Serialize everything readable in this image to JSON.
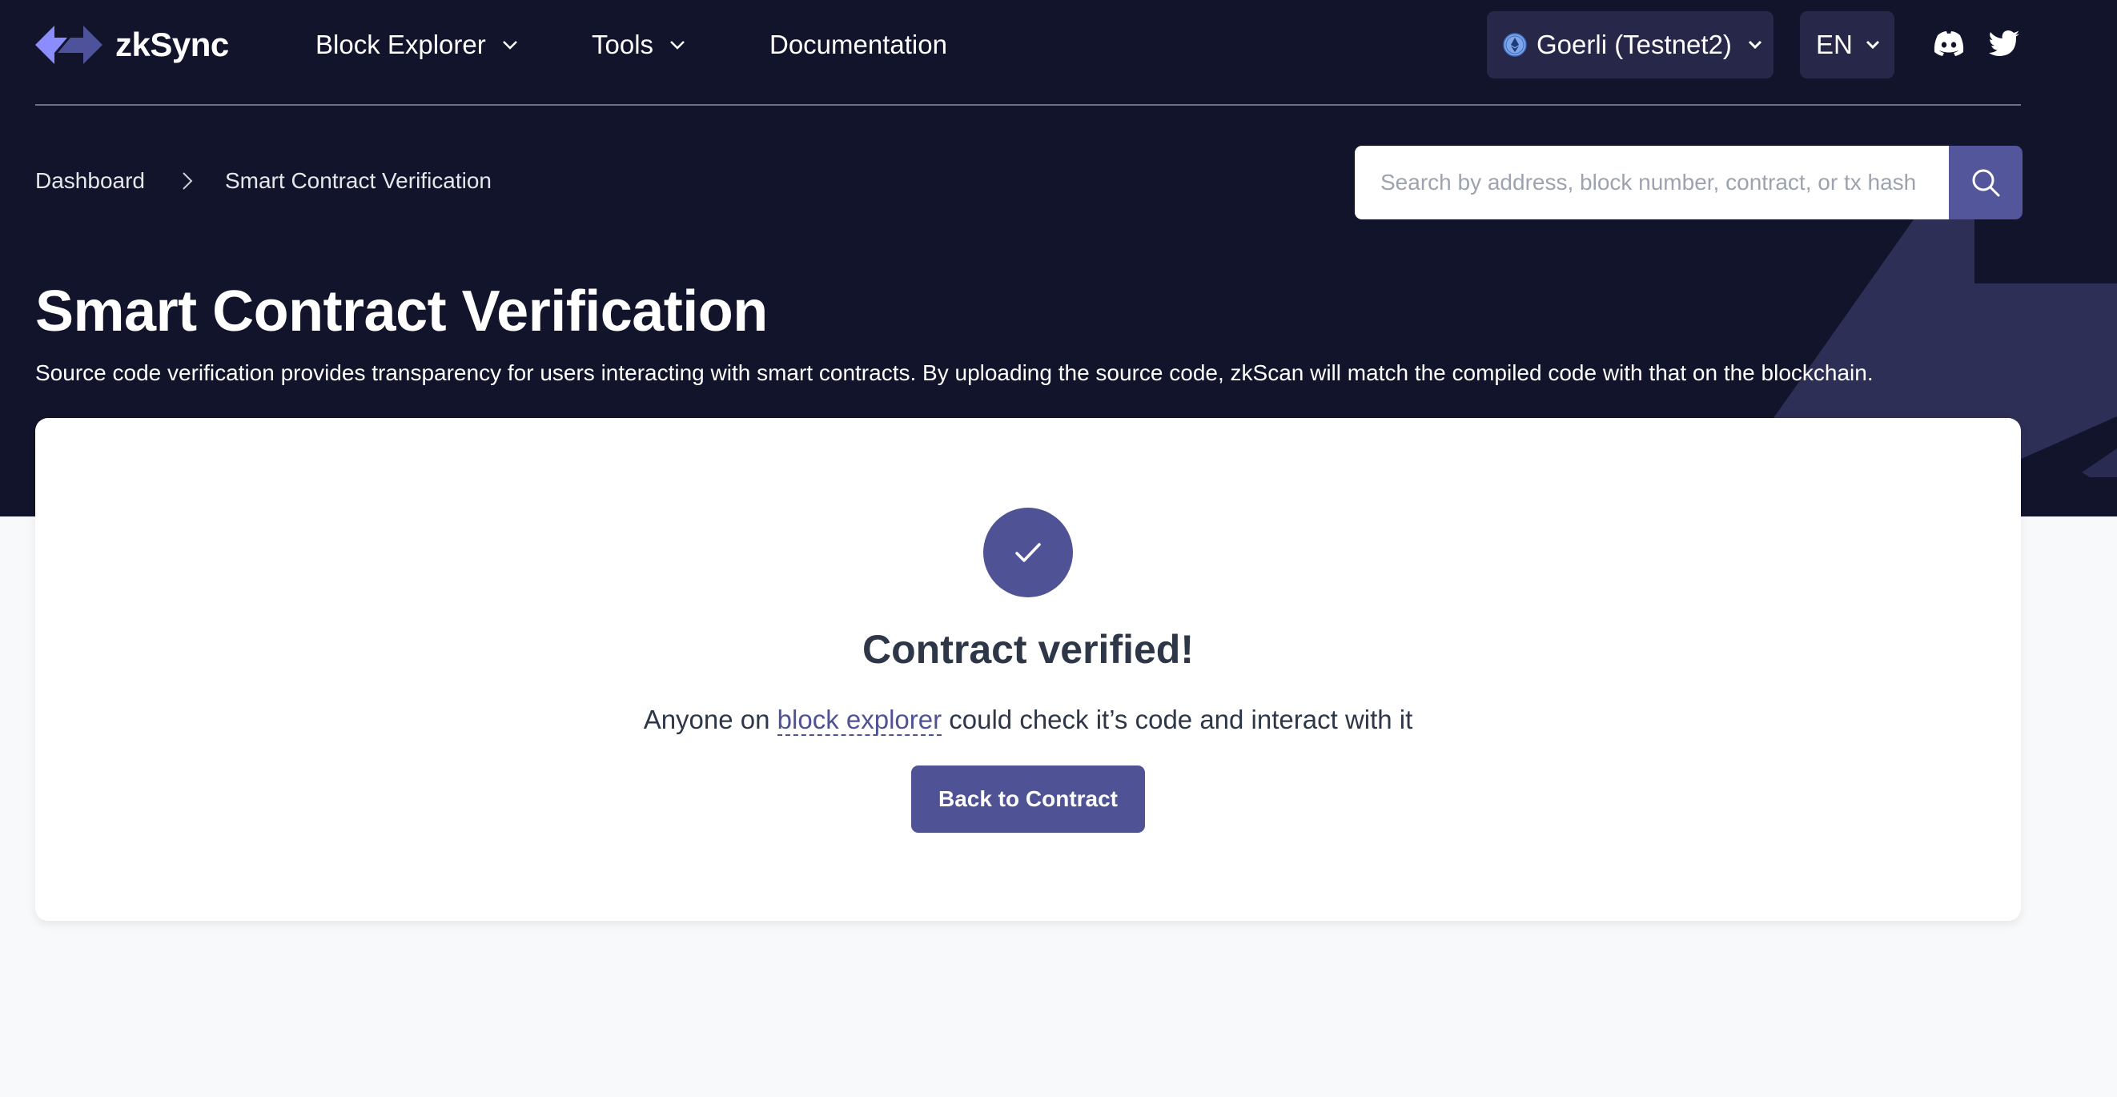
{
  "header": {
    "logo_text": "zkSync",
    "nav": [
      {
        "label": "Block Explorer",
        "has_dropdown": true
      },
      {
        "label": "Tools",
        "has_dropdown": true
      },
      {
        "label": "Documentation",
        "has_dropdown": false
      }
    ],
    "network": {
      "label": "Goerli (Testnet2)",
      "icon": "ethereum-icon"
    },
    "language": {
      "label": "EN"
    },
    "social": [
      {
        "name": "discord",
        "icon": "discord-icon"
      },
      {
        "name": "twitter",
        "icon": "twitter-icon"
      }
    ]
  },
  "breadcrumb": {
    "items": [
      "Dashboard",
      "Smart Contract Verification"
    ]
  },
  "search": {
    "placeholder": "Search by address, block number, contract, or tx hash",
    "value": "",
    "button_icon": "search-icon"
  },
  "page": {
    "title": "Smart Contract Verification",
    "subtitle": "Source code verification provides transparency for users interacting with smart contracts. By uploading the source code, zkScan will match the compiled code with that on the blockchain."
  },
  "result": {
    "status_icon": "check-icon",
    "title": "Contract verified!",
    "text_before": "Anyone on ",
    "link_text": "block explorer",
    "text_after": " could check it’s code and interact with it",
    "button_label": "Back to Contract"
  },
  "colors": {
    "hero_bg": "#11142b",
    "accent": "#4f5294",
    "search_button": "#53569a",
    "pill_bg": "#262749",
    "page_bg": "#f8f9fa"
  }
}
